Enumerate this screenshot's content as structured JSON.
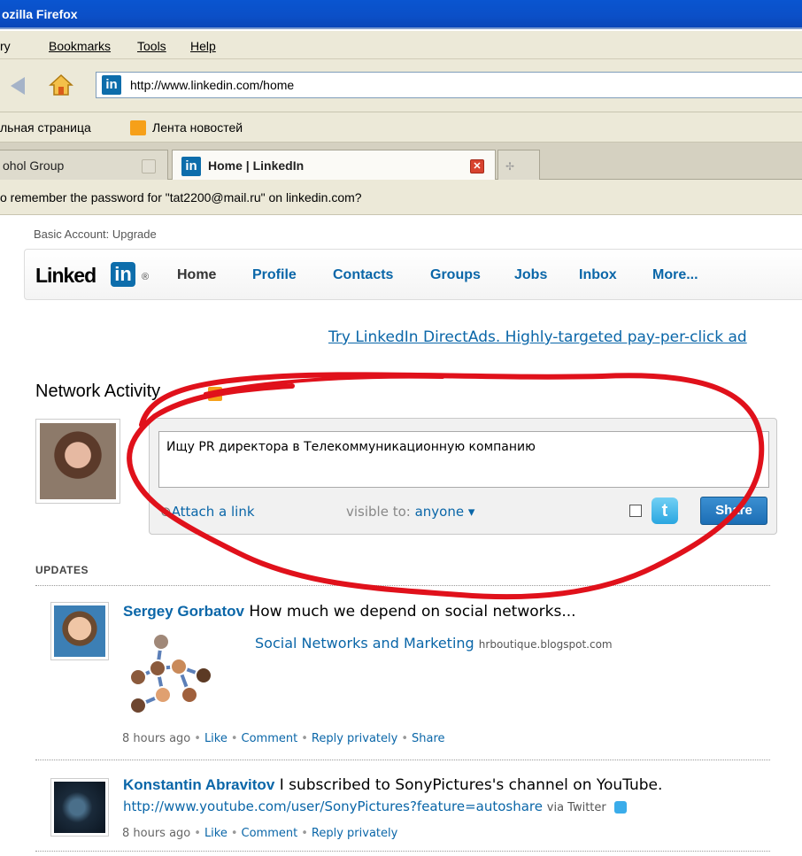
{
  "browser": {
    "title": "ozilla Firefox",
    "menu": [
      "ry",
      "Bookmarks",
      "Tools",
      "Help"
    ],
    "url": "http://www.linkedin.com/home",
    "bookmarks": [
      "льная страница",
      "Лента новостей"
    ],
    "tabs": [
      {
        "label": "ohol Group"
      },
      {
        "label": "Home | LinkedIn"
      }
    ],
    "password_prompt": "o remember the password for \"tat2200@mail.ru\" on linkedin.com?"
  },
  "linkedin": {
    "account": "Basic Account: Upgrade",
    "logo_text": "Linked",
    "logo_in": "in",
    "logo_reg": "®",
    "nav": [
      "Home",
      "Profile",
      "Contacts",
      "Groups",
      "Jobs",
      "Inbox",
      "More..."
    ],
    "ad": "Try LinkedIn DirectAds. Highly-targeted pay-per-click ad",
    "network_activity_title": "Network Activity",
    "share": {
      "text": "Ищу PR директора в Телекоммуникационную компанию",
      "attach_link": "Attach a link",
      "visible_label": "visible to:",
      "visible_value": "anyone ▾",
      "share_button": "Share"
    },
    "updates_header": "UPDATES",
    "updates": [
      {
        "name": "Sergey Gorbatov",
        "text": "How much we depend on social networks...",
        "link_title": "Social Networks and Marketing",
        "link_domain": "hrboutique.blogspot.com",
        "time": "8 hours ago",
        "actions": [
          "Like",
          "Comment",
          "Reply privately",
          "Share"
        ]
      },
      {
        "name": "Konstantin Abravitov",
        "text": "I subscribed to SonyPictures's channel on YouTube.",
        "link": "http://www.youtube.com/user/SonyPictures?feature=autoshare",
        "via": "via Twitter",
        "time": "8 hours ago",
        "actions": [
          "Like",
          "Comment",
          "Reply privately"
        ]
      }
    ]
  },
  "colors": {
    "linkedin_blue": "#0a66a8",
    "ink_red": "#e0111b",
    "titlebar": "#0a55d0"
  },
  "icons": [
    "back-arrow-icon",
    "home-icon",
    "linkedin-favicon-icon",
    "rss-icon",
    "tab-close-icon",
    "new-tab-icon",
    "link-icon",
    "checkbox-icon",
    "twitter-icon"
  ]
}
